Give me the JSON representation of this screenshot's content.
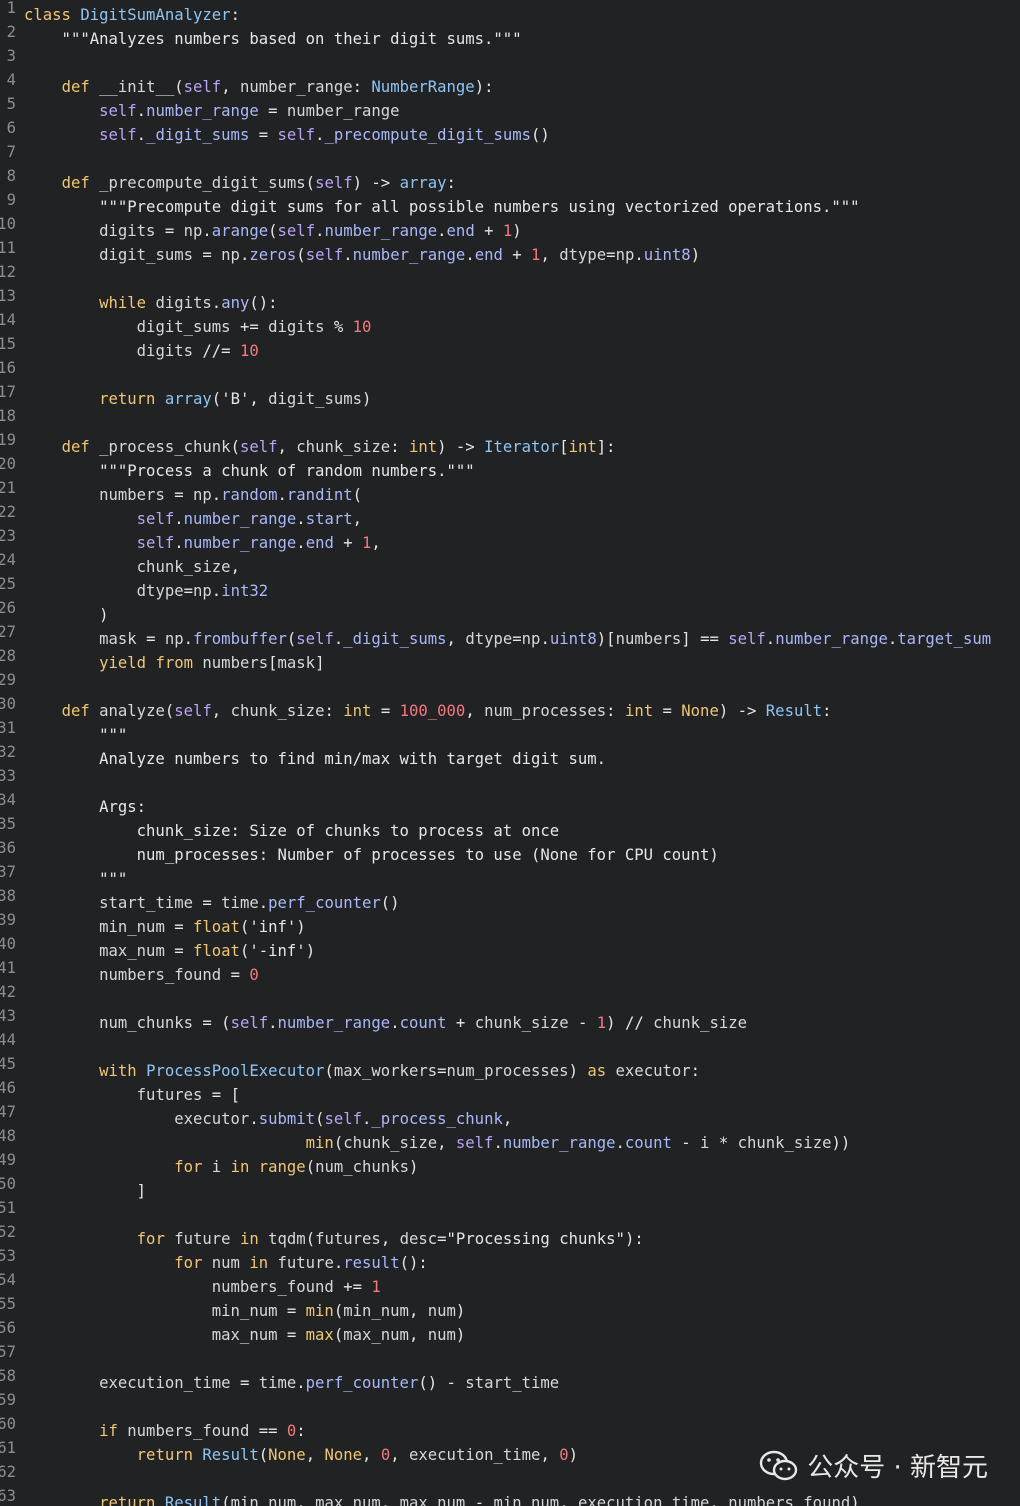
{
  "editor": {
    "lines": [
      {
        "n": "1",
        "text": "class DigitSumAnalyzer:"
      },
      {
        "n": "2",
        "text": "    \"\"\"Analyzes numbers based on their digit sums.\"\"\""
      },
      {
        "n": "3",
        "text": ""
      },
      {
        "n": "4",
        "text": "    def __init__(self, number_range: NumberRange):"
      },
      {
        "n": "5",
        "text": "        self.number_range = number_range"
      },
      {
        "n": "6",
        "text": "        self._digit_sums = self._precompute_digit_sums()"
      },
      {
        "n": "7",
        "text": ""
      },
      {
        "n": "8",
        "text": "    def _precompute_digit_sums(self) -> array:"
      },
      {
        "n": "9",
        "text": "        \"\"\"Precompute digit sums for all possible numbers using vectorized operations.\"\"\""
      },
      {
        "n": "10",
        "text": "        digits = np.arange(self.number_range.end + 1)"
      },
      {
        "n": "11",
        "text": "        digit_sums = np.zeros(self.number_range.end + 1, dtype=np.uint8)"
      },
      {
        "n": "12",
        "text": ""
      },
      {
        "n": "13",
        "text": "        while digits.any():"
      },
      {
        "n": "14",
        "text": "            digit_sums += digits % 10"
      },
      {
        "n": "15",
        "text": "            digits //= 10"
      },
      {
        "n": "16",
        "text": ""
      },
      {
        "n": "17",
        "text": "        return array('B', digit_sums)"
      },
      {
        "n": "18",
        "text": ""
      },
      {
        "n": "19",
        "text": "    def _process_chunk(self, chunk_size: int) -> Iterator[int]:"
      },
      {
        "n": "20",
        "text": "        \"\"\"Process a chunk of random numbers.\"\"\""
      },
      {
        "n": "21",
        "text": "        numbers = np.random.randint("
      },
      {
        "n": "22",
        "text": "            self.number_range.start,"
      },
      {
        "n": "23",
        "text": "            self.number_range.end + 1,"
      },
      {
        "n": "24",
        "text": "            chunk_size,"
      },
      {
        "n": "25",
        "text": "            dtype=np.int32"
      },
      {
        "n": "26",
        "text": "        )"
      },
      {
        "n": "27",
        "text": "        mask = np.frombuffer(self._digit_sums, dtype=np.uint8)[numbers] == self.number_range.target_sum"
      },
      {
        "n": "28",
        "text": "        yield from numbers[mask]"
      },
      {
        "n": "29",
        "text": ""
      },
      {
        "n": "30",
        "text": "    def analyze(self, chunk_size: int = 100_000, num_processes: int = None) -> Result:"
      },
      {
        "n": "31",
        "text": "        \"\"\""
      },
      {
        "n": "32",
        "text": "        Analyze numbers to find min/max with target digit sum."
      },
      {
        "n": "33",
        "text": ""
      },
      {
        "n": "34",
        "text": "        Args:"
      },
      {
        "n": "35",
        "text": "            chunk_size: Size of chunks to process at once"
      },
      {
        "n": "36",
        "text": "            num_processes: Number of processes to use (None for CPU count)"
      },
      {
        "n": "37",
        "text": "        \"\"\""
      },
      {
        "n": "38",
        "text": "        start_time = time.perf_counter()"
      },
      {
        "n": "39",
        "text": "        min_num = float('inf')"
      },
      {
        "n": "40",
        "text": "        max_num = float('-inf')"
      },
      {
        "n": "41",
        "text": "        numbers_found = 0"
      },
      {
        "n": "42",
        "text": ""
      },
      {
        "n": "43",
        "text": "        num_chunks = (self.number_range.count + chunk_size - 1) // chunk_size"
      },
      {
        "n": "44",
        "text": ""
      },
      {
        "n": "45",
        "text": "        with ProcessPoolExecutor(max_workers=num_processes) as executor:"
      },
      {
        "n": "46",
        "text": "            futures = ["
      },
      {
        "n": "47",
        "text": "                executor.submit(self._process_chunk,"
      },
      {
        "n": "48",
        "text": "                              min(chunk_size, self.number_range.count - i * chunk_size))"
      },
      {
        "n": "49",
        "text": "                for i in range(num_chunks)"
      },
      {
        "n": "50",
        "text": "            ]"
      },
      {
        "n": "51",
        "text": ""
      },
      {
        "n": "52",
        "text": "            for future in tqdm(futures, desc=\"Processing chunks\"):"
      },
      {
        "n": "53",
        "text": "                for num in future.result():"
      },
      {
        "n": "54",
        "text": "                    numbers_found += 1"
      },
      {
        "n": "55",
        "text": "                    min_num = min(min_num, num)"
      },
      {
        "n": "56",
        "text": "                    max_num = max(max_num, num)"
      },
      {
        "n": "57",
        "text": ""
      },
      {
        "n": "58",
        "text": "        execution_time = time.perf_counter() - start_time"
      },
      {
        "n": "59",
        "text": ""
      },
      {
        "n": "60",
        "text": "        if numbers_found == 0:"
      },
      {
        "n": "61",
        "text": "            return Result(None, None, 0, execution_time, 0)"
      },
      {
        "n": "62",
        "text": ""
      },
      {
        "n": "63",
        "text": "        return Result(min_num, max_num, max_num - min_num, execution_time, numbers_found)"
      }
    ]
  },
  "watermark": {
    "text": "公众号 · 新智元",
    "icon": "wechat-icon"
  },
  "colors": {
    "background": "#212224",
    "keyword": "#f0c674",
    "class_name": "#8ec5f2",
    "self": "#b9a4f3",
    "number": "#f4787c",
    "text": "#d4d7dc",
    "line_number": "#8b8e94"
  }
}
